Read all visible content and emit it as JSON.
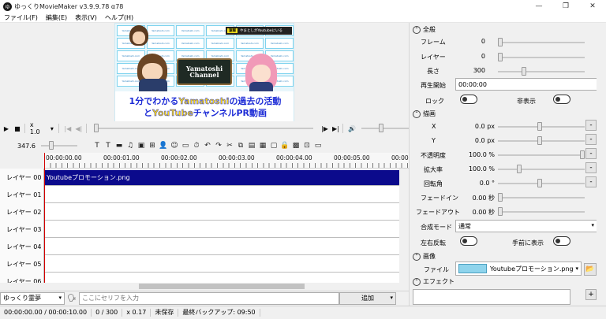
{
  "title": "ゆっくりMovieMaker v3.9.9.78 α78",
  "app_icon": "ゆ",
  "window_controls": {
    "minimize": "—",
    "restore": "❐",
    "close": "✕"
  },
  "menu": [
    "ファイル(F)",
    "編集(E)",
    "表示(V)",
    "ヘルプ(H)"
  ],
  "preview": {
    "tile_text": "Yamatoshi.com",
    "badge_tag": "速報",
    "badge_text": "やまとしがYoutubeにいる",
    "board_line1": "Yamatoshi",
    "board_line2": "Channel",
    "caption1_a": "1分でわかる",
    "caption1_b": "Yamatoshi",
    "caption1_c": "の過去の活動",
    "caption2_a": "と",
    "caption2_b": "YouTube",
    "caption2_c": "チャンネルPR動画"
  },
  "playback": {
    "play": "▶",
    "stop": "■",
    "speed": "x 1.0",
    "speed_arrow": "▾",
    "prev": "|◀",
    "next": "▶|",
    "step_back": "◀|",
    "step_fwd": "|▶",
    "end": "▶|",
    "volume": "🔊",
    "seek_level": 0,
    "volume_level": 0.4
  },
  "toolbar": {
    "zoom_value": "347.6",
    "zoom_level": 0.25,
    "icons": [
      "T",
      "T",
      "▬",
      "♫",
      "▣",
      "⊞",
      "👤",
      "☺",
      "▭",
      "⏱",
      "↶",
      "↷",
      "✂",
      "⧉",
      "▤",
      "▦",
      "▢",
      "🔒",
      "▩",
      "⊡",
      "▭"
    ]
  },
  "ruler": [
    "00:00:00.00",
    "00:00:01.00",
    "00:00:02.00",
    "00:00:03.00",
    "00:00:04.00",
    "00:00:05.00",
    "00:00:0"
  ],
  "layers": [
    "レイヤー 00",
    "レイヤー 01",
    "レイヤー 02",
    "レイヤー 03",
    "レイヤー 04",
    "レイヤー 05",
    "レイヤー 06"
  ],
  "clip_name": "Youtubeプロモーション.png",
  "bottom": {
    "character": "ゆっくり霊夢",
    "voice_icon": "🗣",
    "serif_placeholder": "ここにセリフを入力",
    "add_button": "追加"
  },
  "status": [
    "00:00:00.00 / 00:00:10.00",
    "0 / 300",
    "x 0.17",
    "未保存",
    "最終バックアップ: 09:50"
  ],
  "panel": {
    "general": "全般",
    "frame_label": "フレーム",
    "frame_value": "0",
    "layer_label": "レイヤー",
    "layer_value": "0",
    "length_label": "長さ",
    "length_value": "300",
    "start_label": "再生開始",
    "start_value": "00:00:00",
    "lock_label": "ロック",
    "hide_label": "非表示",
    "draw": "描画",
    "x_label": "X",
    "x_value": "0.0 px",
    "y_label": "Y",
    "y_value": "0.0 px",
    "opacity_label": "不透明度",
    "opacity_value": "100.0 %",
    "scale_label": "拡大率",
    "scale_value": "100.0 %",
    "rotate_label": "回転角",
    "rotate_value": "0.0 °",
    "fadein_label": "フェードイン",
    "fadein_value": "0.00 秒",
    "fadeout_label": "フェードアウト",
    "fadeout_value": "0.00 秒",
    "blend_label": "合成モード",
    "blend_value": "通常",
    "flip_label": "左右反転",
    "front_label": "手前に表示",
    "image": "画像",
    "file_label": "ファイル",
    "file_value": "Youtubeプロモーション.png",
    "effect": "エフェクト",
    "minus": "-",
    "plus": "+",
    "folder": "📂"
  }
}
